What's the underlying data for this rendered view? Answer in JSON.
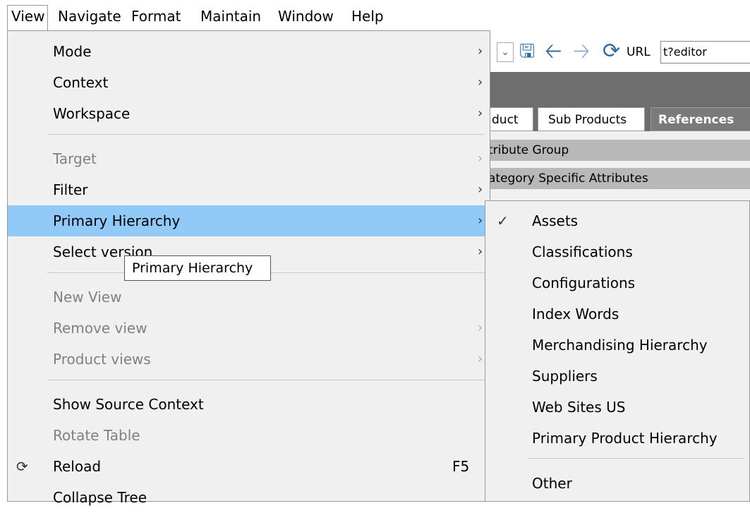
{
  "menubar": {
    "items": [
      "View",
      "Navigate",
      "Format",
      "Maintain",
      "Window",
      "Help"
    ]
  },
  "background": {
    "url_label": "URL",
    "url_value": "t?editor",
    "tabs": [
      "duct",
      "Sub Products",
      "References"
    ],
    "groups": [
      "tribute Group",
      "ategory Specific Attributes"
    ]
  },
  "view_menu": {
    "items": [
      {
        "label": "Mode",
        "submenu": true,
        "enabled": true
      },
      {
        "label": "Context",
        "submenu": true,
        "enabled": true
      },
      {
        "label": "Workspace",
        "submenu": true,
        "enabled": true
      },
      {
        "label": "Target",
        "submenu": true,
        "enabled": false
      },
      {
        "label": "Filter",
        "submenu": true,
        "enabled": true
      },
      {
        "label": "Primary Hierarchy",
        "submenu": true,
        "enabled": true,
        "highlighted": true
      },
      {
        "label": "Select version",
        "submenu": true,
        "enabled": true
      },
      {
        "label": "New View",
        "submenu": false,
        "enabled": false
      },
      {
        "label": "Remove view",
        "submenu": true,
        "enabled": false
      },
      {
        "label": "Product views",
        "submenu": true,
        "enabled": false
      },
      {
        "label": "Show Source Context",
        "submenu": false,
        "enabled": true
      },
      {
        "label": "Rotate Table",
        "submenu": false,
        "enabled": false
      },
      {
        "label": "Reload",
        "submenu": false,
        "enabled": true,
        "accelerator": "F5",
        "icon": "reload-icon"
      },
      {
        "label": "Collapse Tree",
        "submenu": false,
        "enabled": true
      }
    ]
  },
  "tooltip": "Primary Hierarchy",
  "submenu": {
    "items": [
      {
        "label": "Assets",
        "checked": true
      },
      {
        "label": "Classifications",
        "checked": false
      },
      {
        "label": "Configurations",
        "checked": false
      },
      {
        "label": "Index Words",
        "checked": false
      },
      {
        "label": "Merchandising Hierarchy",
        "checked": false
      },
      {
        "label": "Suppliers",
        "checked": false
      },
      {
        "label": "Web Sites US",
        "checked": false
      },
      {
        "label": "Primary Product Hierarchy",
        "checked": false
      },
      {
        "label": "Other",
        "checked": false
      }
    ]
  },
  "colors": {
    "highlight": "#91c9f7",
    "menu_bg": "#f0f0f0",
    "disabled_text": "#808080"
  }
}
